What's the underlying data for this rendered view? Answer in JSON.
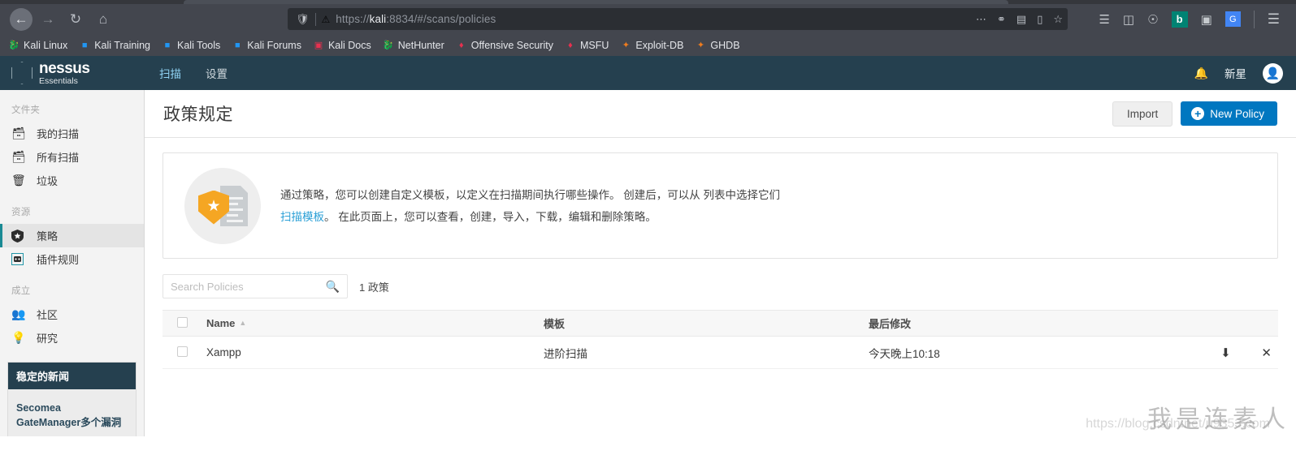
{
  "browser": {
    "nav": {
      "back": "back-arrow",
      "forward": "forward-arrow",
      "reload": "reload-icon",
      "home": "home-icon"
    },
    "url": {
      "protocol": "https://",
      "host": "kali",
      "rest": ":8834/#/scans/policies",
      "full": "https://kali:8834/#/scans/policies",
      "shield_icon": "tracking-shield-icon",
      "lock_icon": "insecure-warning-icon"
    },
    "url_actions": [
      "more-options-icon",
      "pocket-icon",
      "translate-icon",
      "reader-icon",
      "bookmark-star-icon"
    ],
    "toolbar_right": [
      "library-icon",
      "sidebar-icon",
      "account-icon",
      "bing-icon",
      "translator-icon",
      "google-translate-icon",
      "menu-icon"
    ],
    "bookmarks": [
      {
        "label": "Kali Linux",
        "icon": "kali-dragon-icon"
      },
      {
        "label": "Kali Training",
        "icon": "kali-training-icon"
      },
      {
        "label": "Kali Tools",
        "icon": "kali-tools-icon"
      },
      {
        "label": "Kali Forums",
        "icon": "kali-forums-icon"
      },
      {
        "label": "Kali Docs",
        "icon": "kali-docs-icon"
      },
      {
        "label": "NetHunter",
        "icon": "nethunter-icon"
      },
      {
        "label": "Offensive Security",
        "icon": "offsec-icon"
      },
      {
        "label": "MSFU",
        "icon": "msfu-icon"
      },
      {
        "label": "Exploit-DB",
        "icon": "exploitdb-icon"
      },
      {
        "label": "GHDB",
        "icon": "ghdb-icon"
      }
    ]
  },
  "app": {
    "logo": {
      "name": "nessus",
      "tm": "®",
      "edition": "Essentials"
    },
    "tabs": [
      {
        "label": "扫描",
        "active": true
      },
      {
        "label": "设置",
        "active": false
      }
    ],
    "header_right": {
      "bell_icon": "notification-bell-icon",
      "user_name": "新星",
      "avatar_icon": "user-avatar-icon"
    }
  },
  "sidebar": {
    "groups": [
      {
        "label": "文件夹",
        "items": [
          {
            "label": "我的扫描",
            "icon": "folder-icon",
            "active": false
          },
          {
            "label": "所有扫描",
            "icon": "folder-icon",
            "active": false
          },
          {
            "label": "垃圾",
            "icon": "trash-icon",
            "active": false
          }
        ]
      },
      {
        "label": "资源",
        "items": [
          {
            "label": "策略",
            "icon": "shield-star-icon",
            "active": true
          },
          {
            "label": "插件规则",
            "icon": "plugin-icon",
            "active": false
          }
        ]
      },
      {
        "label": "成立",
        "items": [
          {
            "label": "社区",
            "icon": "community-icon",
            "active": false
          },
          {
            "label": "研究",
            "icon": "research-bulb-icon",
            "active": false
          }
        ]
      }
    ],
    "news": {
      "title": "稳定的新闻",
      "items": [
        {
          "title": "Secomea GateManager多个漏洞"
        }
      ]
    }
  },
  "page": {
    "title": "政策规定",
    "import_label": "Import",
    "new_policy_label": "New Policy",
    "plus_icon": "plus-circle-icon"
  },
  "info_panel": {
    "icon": "policy-shield-document-icon",
    "line1_a": "通过策略，您可以创建自定义模板，以定义在扫描期间执行哪些操作。 创建后，可以从 列表中选择它们",
    "link_text": "扫描模板",
    "line2_b": "。 在此页面上，您可以查看，创建，导入，下载，编辑和删除策略。"
  },
  "toolbar": {
    "search_placeholder": "Search Policies",
    "search_value": "",
    "search_icon": "search-icon",
    "count_text": "1 政策"
  },
  "table": {
    "columns": [
      {
        "key": "check",
        "label": ""
      },
      {
        "key": "name",
        "label": "Name",
        "sorted": "asc",
        "sort_icon": "sort-asc-caret-icon"
      },
      {
        "key": "template",
        "label": "模板"
      },
      {
        "key": "modified",
        "label": "最后修改"
      },
      {
        "key": "actions",
        "label": ""
      }
    ],
    "rows": [
      {
        "name": "Xampp",
        "template": "进阶扫描",
        "modified": "今天晚上10:18",
        "actions": [
          "download-icon",
          "delete-icon"
        ]
      }
    ]
  },
  "watermark": {
    "text": "我是连素人",
    "url": "https://blog.csdn.net/u9353.com"
  },
  "colors": {
    "accent_blue": "#0077c0",
    "header_dark": "#25404f",
    "active_teal": "#1a8a94",
    "shield_orange": "#f5a623",
    "link_blue": "#2a9fd6",
    "chrome_gray": "#43464e"
  }
}
